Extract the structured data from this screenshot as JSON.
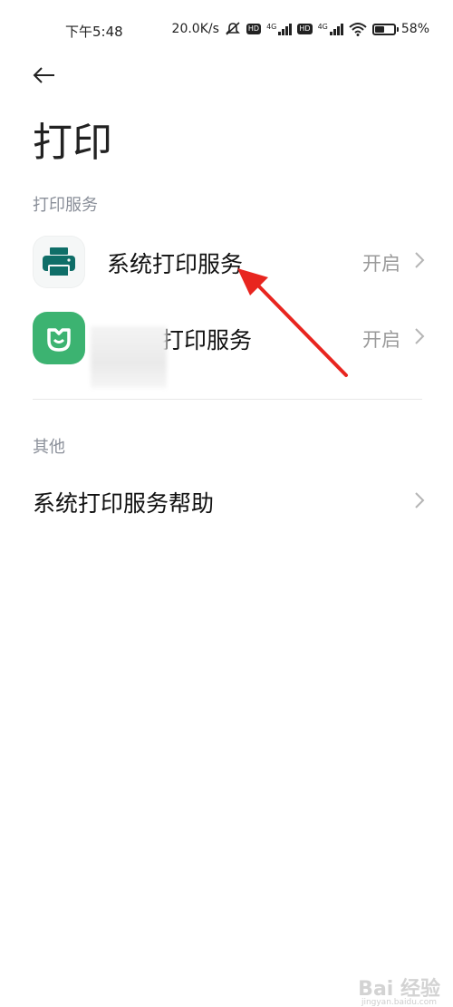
{
  "status_bar": {
    "time": "下午5:48",
    "net_speed": "20.0K/s",
    "net_type_1": "4G",
    "net_type_2": "4G",
    "hd_label": "HD",
    "battery_percent": "58%",
    "battery_level": 0.58
  },
  "header": {
    "back_icon": "back-arrow-icon",
    "title": "打印"
  },
  "sections": {
    "print_services": {
      "header": "打印服务",
      "items": [
        {
          "label": "系统打印服务",
          "status": "开启",
          "icon": "printer-icon",
          "icon_bg": "#f5f7f7",
          "icon_color": "#0f6e68"
        },
        {
          "label": "打印服务",
          "status": "开启",
          "icon": "mi-home-icon",
          "icon_bg": "#3cb371",
          "icon_color": "#ffffff"
        }
      ]
    },
    "other": {
      "header": "其他",
      "items": [
        {
          "label": "系统打印服务帮助"
        }
      ]
    }
  },
  "annotation": {
    "arrow_color": "#e8251f"
  },
  "watermark": {
    "text": "Bai 经验",
    "sub": "jingyan.baidu.com"
  }
}
